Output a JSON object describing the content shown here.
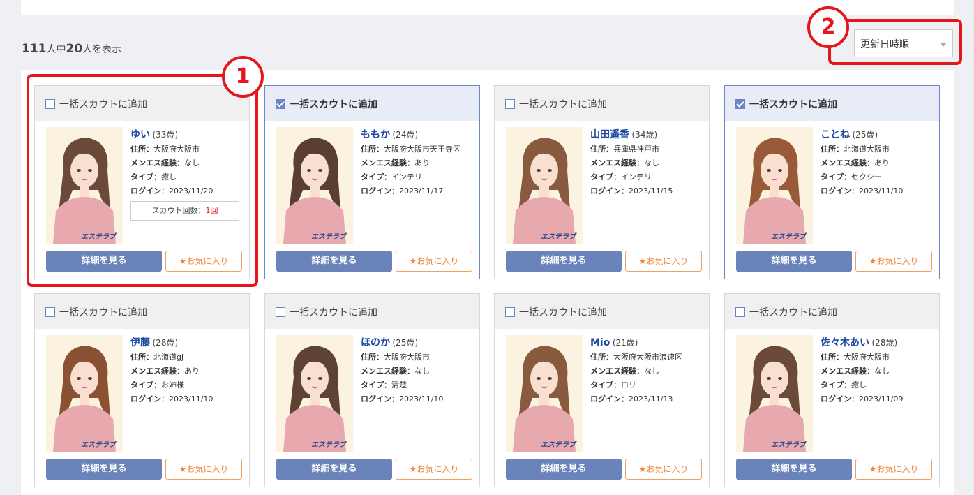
{
  "result_count": {
    "total": "111",
    "mid": "人中",
    "shown": "20",
    "suffix": "人を表示"
  },
  "sort": {
    "selected": "更新日時順"
  },
  "annotations": {
    "badge1": "1",
    "badge2": "2"
  },
  "colors": {
    "accent_red": "#e5161c",
    "detail_button": "#6b83bb",
    "favorite": "#f0873a",
    "name_link": "#1c4aa0"
  },
  "labels": {
    "bulk_scout": "一括スカウトに追加",
    "address": "住所：",
    "experience": "メンエス経験：",
    "type": "タイプ：",
    "login": "ログイン：",
    "detail_button": "詳細を見る",
    "favorite_button": "お気に入り",
    "favorite_icon": "★",
    "scout_count_label": "スカウト回数：",
    "photo_logo": "エステラブ"
  },
  "cards": [
    {
      "name": "ゆい",
      "age": "(33歳)",
      "address": "大阪府大阪市",
      "experience": "なし",
      "type": "癒し",
      "login": "2023/11/20",
      "checked": false,
      "scout_count": "1回",
      "hair": "#6b4a3a"
    },
    {
      "name": "ももか",
      "age": "(24歳)",
      "address": "大阪府大阪市天王寺区",
      "experience": "あり",
      "type": "インテリ",
      "login": "2023/11/17",
      "checked": true,
      "hair": "#5a3e32"
    },
    {
      "name": "山田遥香",
      "age": "(34歳)",
      "address": "兵庫県神戸市",
      "experience": "なし",
      "type": "インテリ",
      "login": "2023/11/15",
      "checked": false,
      "hair": "#8a5a40"
    },
    {
      "name": "ことね",
      "age": "(25歳)",
      "address": "北海道大阪市",
      "experience": "あり",
      "type": "セクシー",
      "login": "2023/11/10",
      "checked": true,
      "hair": "#9a5a3a"
    },
    {
      "name": "伊藤",
      "age": "(28歳)",
      "address": "北海道gj",
      "experience": "あり",
      "type": "お姉様",
      "login": "2023/11/10",
      "checked": false,
      "hair": "#8a5232"
    },
    {
      "name": "ほのか",
      "age": "(25歳)",
      "address": "大阪府大阪市",
      "experience": "なし",
      "type": "清楚",
      "login": "2023/11/10",
      "checked": false,
      "hair": "#5e4234"
    },
    {
      "name": "Mio",
      "age": "(21歳)",
      "address": "大阪府大阪市浪速区",
      "experience": "なし",
      "type": "ロリ",
      "login": "2023/11/13",
      "checked": false,
      "hair": "#8a5a3e"
    },
    {
      "name": "佐々木あい",
      "age": "(28歳)",
      "address": "大阪府大阪市",
      "experience": "なし",
      "type": "癒し",
      "login": "2023/11/09",
      "checked": false,
      "hair": "#6b4a3a"
    }
  ]
}
